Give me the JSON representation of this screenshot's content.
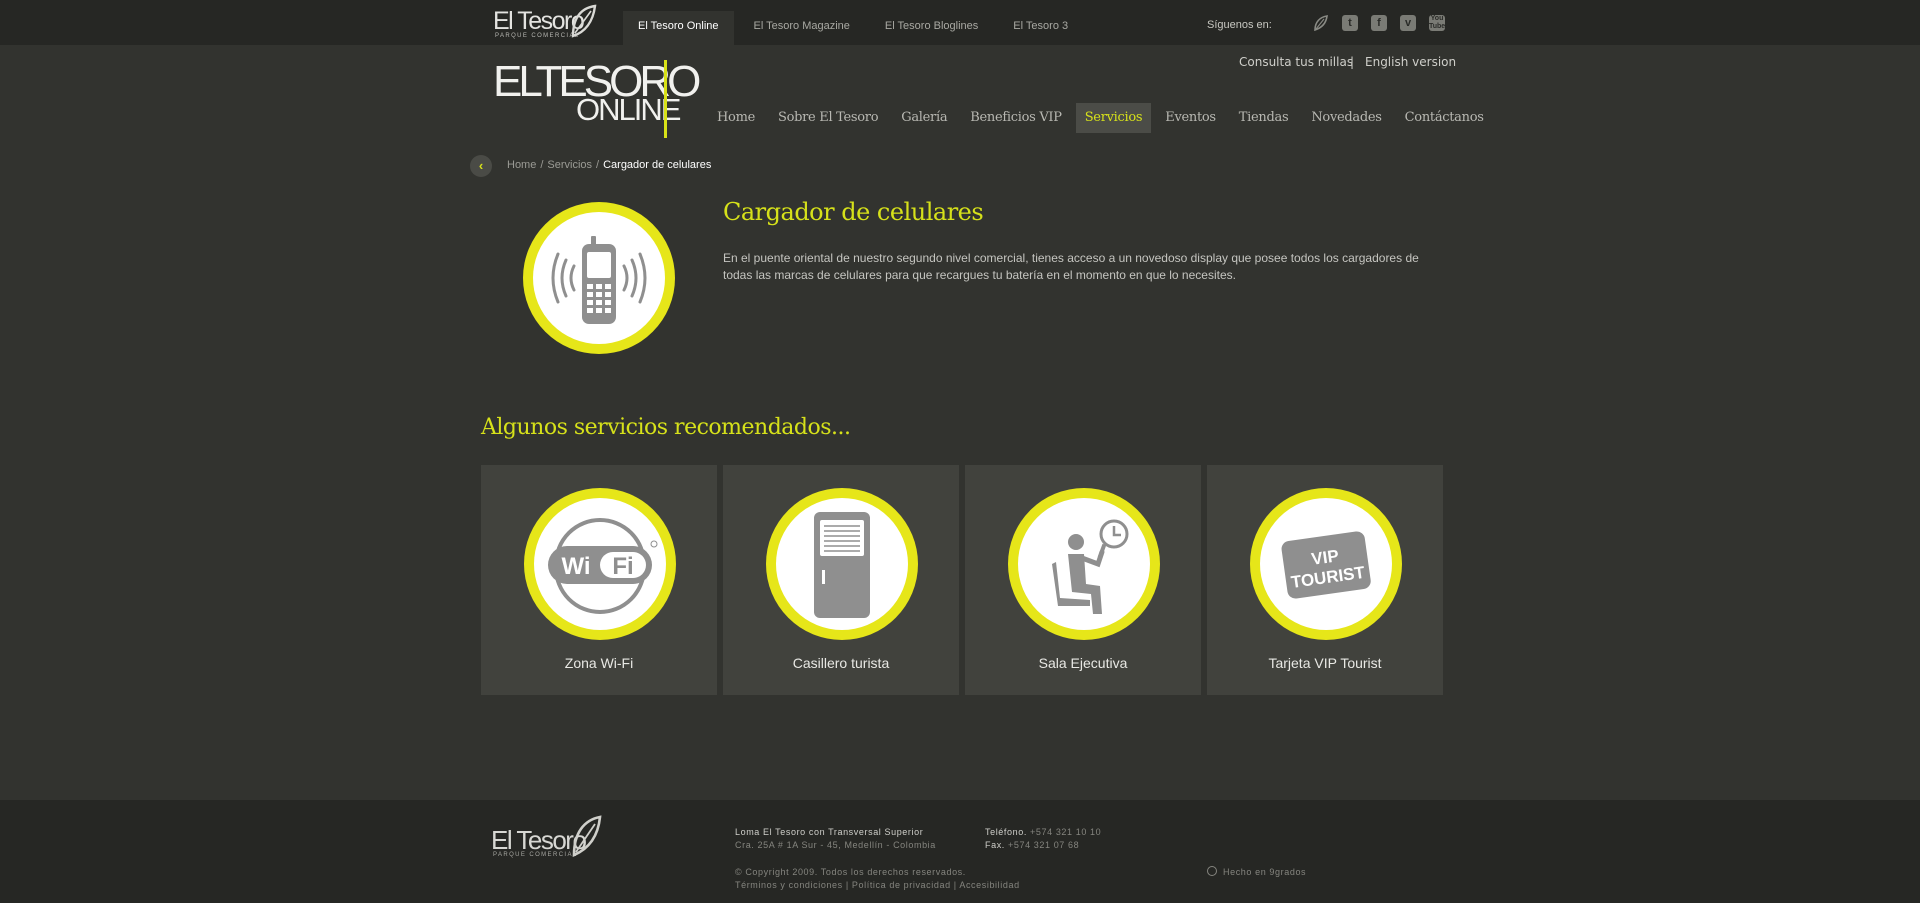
{
  "topbar": {
    "brand": "El Tesoro",
    "brand_sub": "PARQUE COMERCIAL",
    "tabs": [
      {
        "label": "El Tesoro Online"
      },
      {
        "label": "El Tesoro Magazine"
      },
      {
        "label": "El Tesoro Bloglines"
      },
      {
        "label": "El Tesoro 3"
      }
    ],
    "follow_label": "Síguenos en:",
    "social_icons": [
      "leaf-icon",
      "twitter-icon",
      "facebook-icon",
      "vimeo-icon",
      "youtube-icon"
    ]
  },
  "header": {
    "brand_line1": "ELTESORO",
    "brand_line2": "ONLINE",
    "links": {
      "miles": "Consulta tus millas",
      "separator": "|",
      "english": "English version"
    },
    "nav": [
      {
        "label": "Home"
      },
      {
        "label": "Sobre El Tesoro"
      },
      {
        "label": "Galería"
      },
      {
        "label": "Beneficios VIP"
      },
      {
        "label": "Servicios"
      },
      {
        "label": "Eventos"
      },
      {
        "label": "Tiendas"
      },
      {
        "label": "Novedades"
      },
      {
        "label": "Contáctanos"
      }
    ],
    "active_nav": "Servicios"
  },
  "breadcrumb": {
    "items": [
      "Home",
      "Servicios"
    ],
    "current": "Cargador de celulares",
    "separator": "/"
  },
  "service": {
    "title": "Cargador de celulares",
    "description": "En el puente oriental de nuestro segundo nivel comercial, tienes acceso a un novedoso display que posee todos los cargadores de todas las marcas de celulares para que recargues tu batería en el momento en que lo necesites.",
    "icon": "mobile-phone-icon"
  },
  "recommended": {
    "title": "Algunos servicios recomendados...",
    "cards": [
      {
        "label": "Zona Wi-Fi",
        "icon": "wifi-icon",
        "icon_text": "WiFi"
      },
      {
        "label": "Casillero turista",
        "icon": "locker-icon"
      },
      {
        "label": "Sala Ejecutiva",
        "icon": "executive-lounge-icon"
      },
      {
        "label": "Tarjeta VIP Tourist",
        "icon": "vip-card-icon",
        "icon_text_1": "VIP",
        "icon_text_2": "TOURIST"
      }
    ]
  },
  "footer": {
    "brand": "El Tesoro",
    "brand_sub": "PARQUE COMERCIAL",
    "address_line1": "Loma El Tesoro con Transversal Superior",
    "address_line2": "Cra. 25A # 1A Sur - 45, Medellín - Colombia",
    "phone_label": "Teléfono.",
    "phone": "+574 321 10 10",
    "fax_label": "Fax.",
    "fax": "+574 321 07 68",
    "copyright": "© Copyright 2009. Todos los derechos reservados.",
    "legal_links": [
      {
        "label": "Términos y condiciones"
      },
      {
        "label": "Política de privacidad"
      },
      {
        "label": "Accesibilidad"
      }
    ],
    "legal_separator": "|",
    "made_by": "Hecho en 9grados"
  },
  "colors": {
    "accent": "#d6e11a",
    "circle_ring": "#e6e619",
    "background": "#32332f",
    "topbar": "#262724",
    "card": "#41423d"
  }
}
